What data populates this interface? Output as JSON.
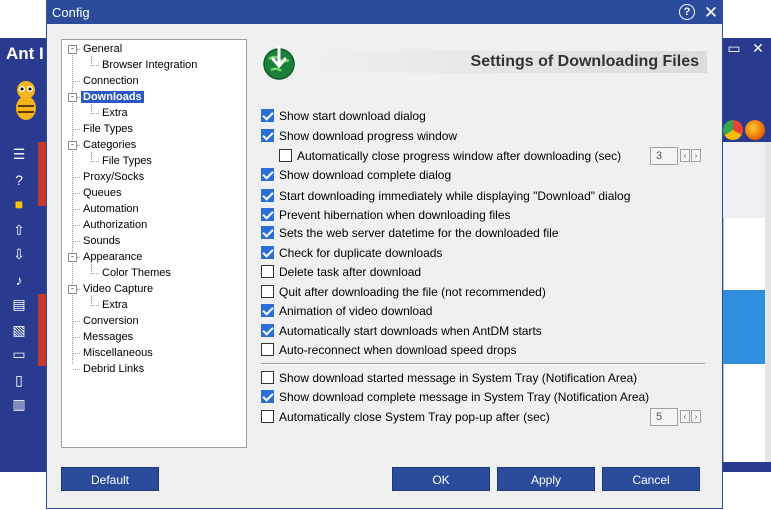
{
  "background_app": {
    "title": "Ant I",
    "colors": {
      "frame": "#2a3b8f",
      "accent": "#c23a2a",
      "selection": "#2f8fde"
    }
  },
  "dialog": {
    "title": "Config",
    "help_glyph": "?",
    "close_glyph": "✕"
  },
  "tree": {
    "items": [
      {
        "label": "General",
        "level": 0,
        "expander": "-"
      },
      {
        "label": "Browser Integration",
        "level": 1
      },
      {
        "label": "Connection",
        "level": 0
      },
      {
        "label": "Downloads",
        "level": 0,
        "expander": "-",
        "selected": true
      },
      {
        "label": "Extra",
        "level": 1
      },
      {
        "label": "File Types",
        "level": 0
      },
      {
        "label": "Categories",
        "level": 0,
        "expander": "-"
      },
      {
        "label": "File Types",
        "level": 1
      },
      {
        "label": "Proxy/Socks",
        "level": 0
      },
      {
        "label": "Queues",
        "level": 0
      },
      {
        "label": "Automation",
        "level": 0
      },
      {
        "label": "Authorization",
        "level": 0
      },
      {
        "label": "Sounds",
        "level": 0
      },
      {
        "label": "Appearance",
        "level": 0,
        "expander": "-"
      },
      {
        "label": "Color Themes",
        "level": 1
      },
      {
        "label": "Video Capture",
        "level": 0,
        "expander": "-"
      },
      {
        "label": "Extra",
        "level": 1
      },
      {
        "label": "Conversion",
        "level": 0
      },
      {
        "label": "Messages",
        "level": 0
      },
      {
        "label": "Miscellaneous",
        "level": 0
      },
      {
        "label": "Debrid Links",
        "level": 0
      }
    ]
  },
  "header": {
    "title": "Settings of Downloading Files",
    "icon": "globe-download-icon"
  },
  "options": [
    {
      "label": "Show start download dialog",
      "checked": true
    },
    {
      "label": "Show download progress window",
      "checked": true
    },
    {
      "label": "Automatically close progress window after downloading (sec)",
      "checked": false,
      "spin_value": "3"
    },
    {
      "label": "Show download complete dialog",
      "checked": true
    },
    {
      "label": "Start downloading immediately while displaying \"Download\" dialog",
      "checked": true
    },
    {
      "label": "Prevent hibernation when downloading files",
      "checked": true
    },
    {
      "label": "Sets the web server datetime for the downloaded file",
      "checked": true
    },
    {
      "label": "Check for duplicate downloads",
      "checked": true
    },
    {
      "label": "Delete task after download",
      "checked": false
    },
    {
      "label": "Quit after downloading the file (not recommended)",
      "checked": false
    },
    {
      "label": "Animation of video download",
      "checked": true
    },
    {
      "label": "Automatically start downloads when AntDM starts",
      "checked": true
    },
    {
      "label": "Auto-reconnect when download speed drops",
      "checked": false
    }
  ],
  "tray_options": [
    {
      "label": "Show download started message in System Tray (Notification Area)",
      "checked": false
    },
    {
      "label": "Show download complete message in System Tray (Notification Area)",
      "checked": true
    },
    {
      "label": "Automatically close System Tray pop-up after (sec)",
      "checked": false,
      "spin_value": "5"
    }
  ],
  "buttons": {
    "default": "Default",
    "ok": "OK",
    "apply": "Apply",
    "cancel": "Cancel"
  },
  "spin_arrows": {
    "left": "‹",
    "right": "›"
  },
  "colors": {
    "titlebar": "#2b4c9b",
    "checkbox_on": "#2b6fd6",
    "tree_selected": "#2b59c3"
  }
}
